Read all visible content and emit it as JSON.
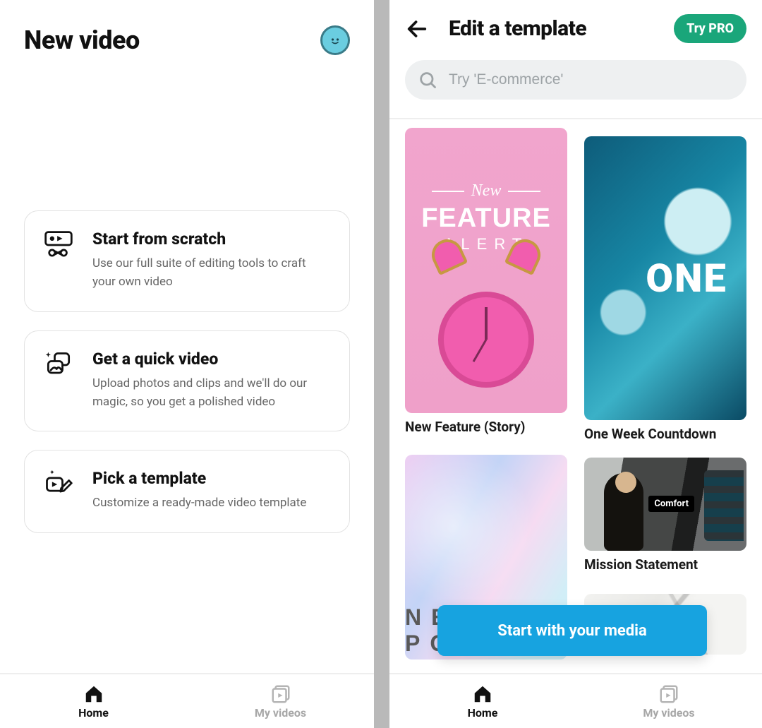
{
  "left": {
    "title": "New video",
    "options": [
      {
        "title": "Start from scratch",
        "desc": "Use our full suite of editing tools to craft your own video"
      },
      {
        "title": "Get a quick video",
        "desc": "Upload photos and clips and we'll do our magic, so you get a polished video"
      },
      {
        "title": "Pick a template",
        "desc": "Customize a ready-made video template"
      }
    ],
    "nav": {
      "home": "Home",
      "myvideos": "My videos"
    }
  },
  "right": {
    "title": "Edit a template",
    "try_pro": "Try PRO",
    "search_placeholder": "Try 'E-commerce'",
    "templates": [
      {
        "label": "New Feature (Story)",
        "overlay": {
          "top": "New",
          "mid": "FEATURE",
          "bot": "ALERT"
        }
      },
      {
        "label": "One Week Countdown",
        "overlay": {
          "big": "ONE"
        }
      },
      {
        "label": "",
        "overlay": {
          "text": "NEW POST"
        }
      },
      {
        "label": "Mission Statement",
        "overlay": {
          "badge": "Comfort"
        }
      },
      {
        "label": ""
      }
    ],
    "cta": "Start with your media",
    "nav": {
      "home": "Home",
      "myvideos": "My videos"
    }
  }
}
